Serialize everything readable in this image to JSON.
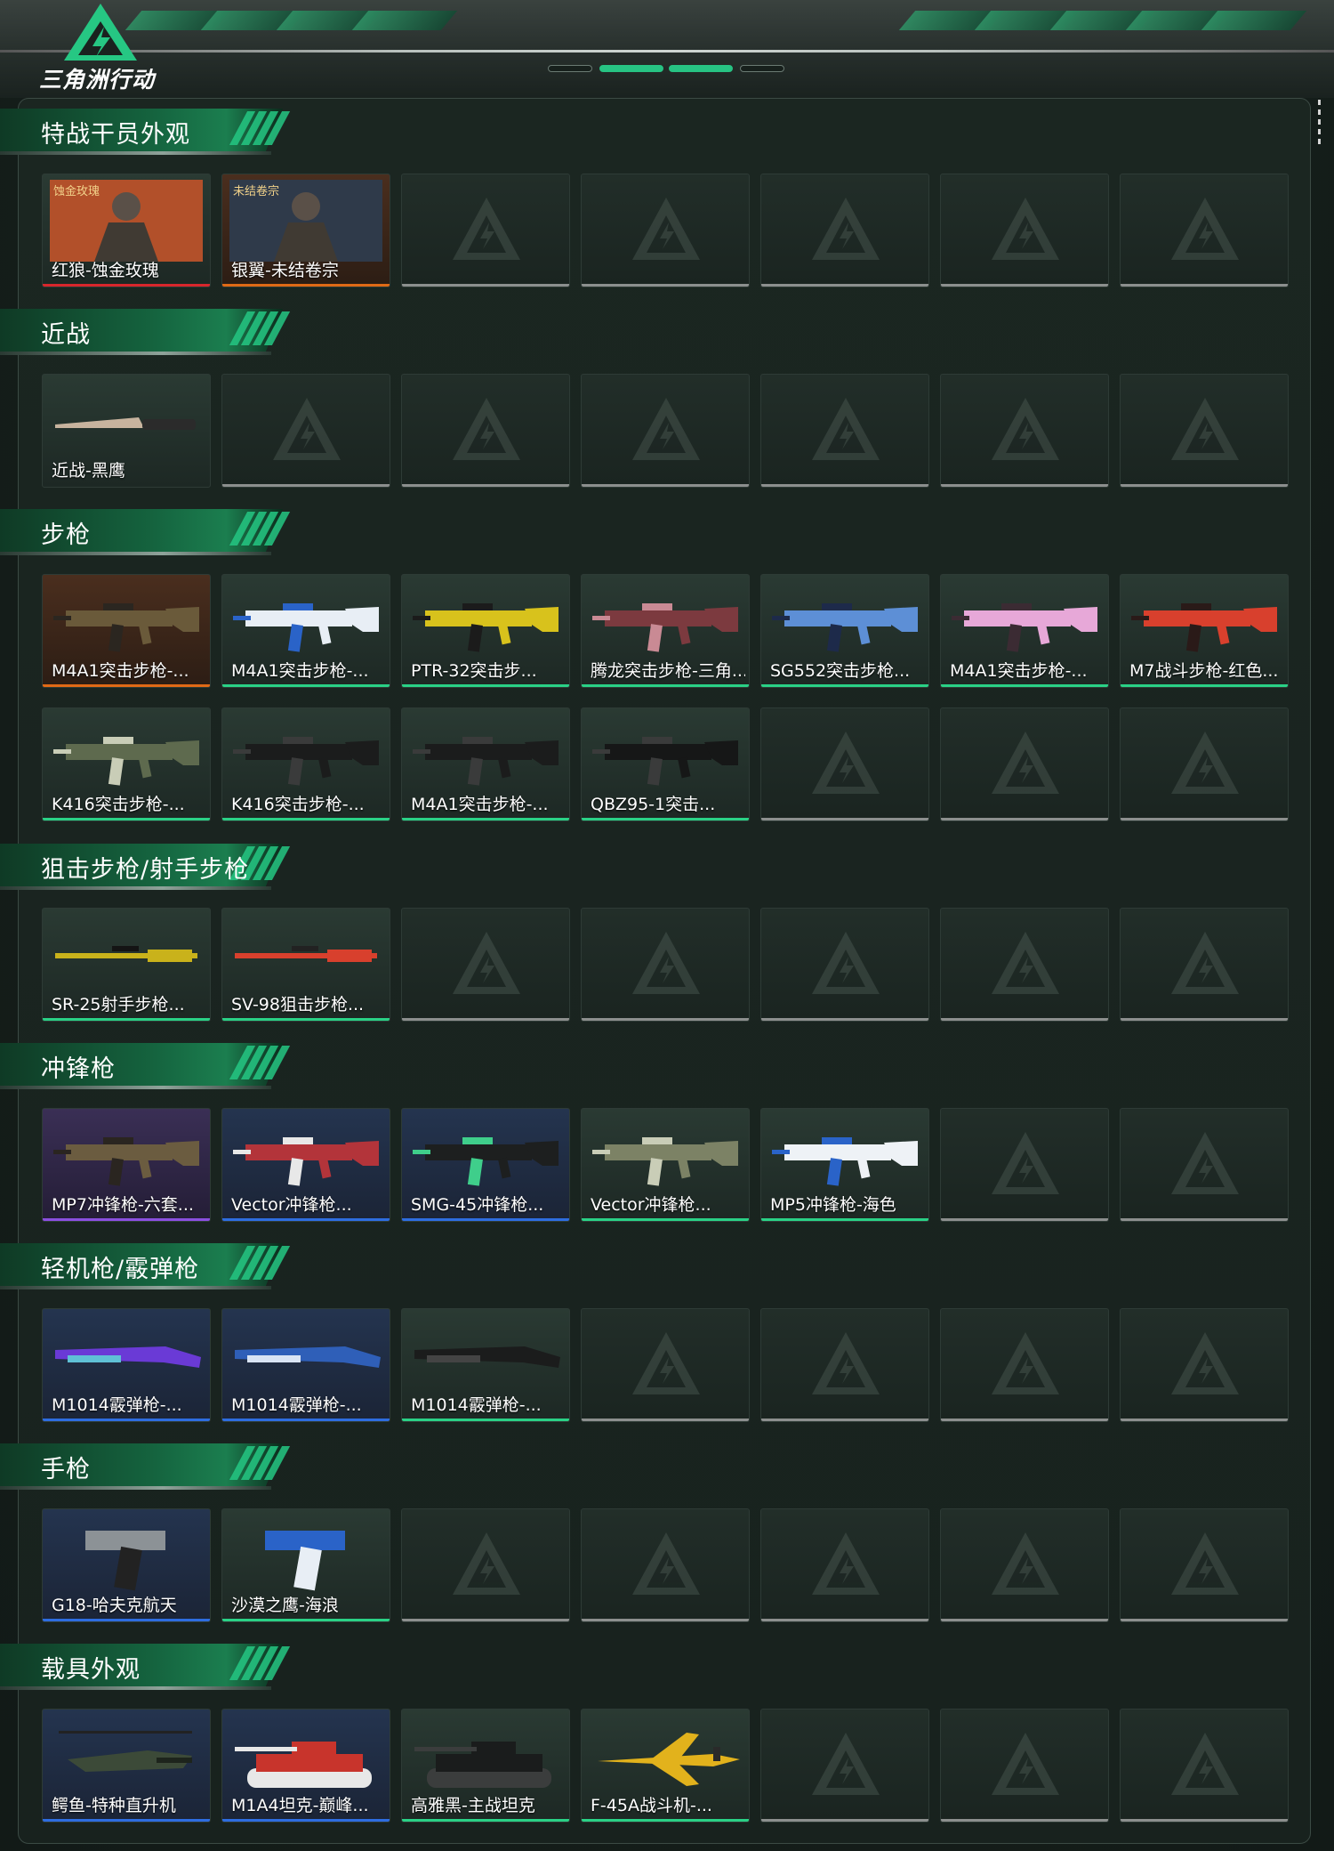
{
  "header": {
    "logo_text": "三角洲行动",
    "accent": "#27c383"
  },
  "sections": [
    {
      "title": "特战干员外观",
      "items": [
        {
          "label": "红狼-蚀金玫瑰",
          "quality": "red",
          "icon": "operator-red-wolf",
          "badge": "蚀金玫瑰"
        },
        {
          "label": "银翼-未结卷宗",
          "quality": "orange",
          "icon": "operator-silver-wing",
          "badge": "未结卷宗"
        }
      ]
    },
    {
      "title": "近战",
      "items": [
        {
          "label": "近战-黑鹰",
          "quality": "none",
          "icon": "knife"
        }
      ]
    },
    {
      "title": "步枪",
      "items": [
        {
          "label": "M4A1突击步枪-...",
          "quality": "orange",
          "icon": "rifle-camo-tan"
        },
        {
          "label": "M4A1突击步枪-...",
          "quality": "green",
          "icon": "rifle-white-blue"
        },
        {
          "label": "PTR-32突击步...",
          "quality": "green",
          "icon": "rifle-yellow-black"
        },
        {
          "label": "腾龙突击步枪-三角...",
          "quality": "green",
          "icon": "rifle-red-camo"
        },
        {
          "label": "SG552突击步枪...",
          "quality": "green",
          "icon": "rifle-blue-marble"
        },
        {
          "label": "M4A1突击步枪-...",
          "quality": "green",
          "icon": "rifle-pink"
        },
        {
          "label": "M7战斗步枪-红色...",
          "quality": "green",
          "icon": "rifle-red"
        },
        {
          "label": "K416突击步枪-...",
          "quality": "green",
          "icon": "rifle-green-camo"
        },
        {
          "label": "K416突击步枪-...",
          "quality": "green",
          "icon": "rifle-black"
        },
        {
          "label": "M4A1突击步枪-...",
          "quality": "green",
          "icon": "rifle-black"
        },
        {
          "label": "QBZ95-1突击...",
          "quality": "green",
          "icon": "rifle-bullpup-black"
        }
      ]
    },
    {
      "title": "狙击步枪/射手步枪",
      "items": [
        {
          "label": "SR-25射手步枪...",
          "quality": "green",
          "icon": "sniper-yellow"
        },
        {
          "label": "SV-98狙击步枪...",
          "quality": "green",
          "icon": "sniper-red"
        }
      ]
    },
    {
      "title": "冲锋枪",
      "items": [
        {
          "label": "MP7冲锋枪-六套...",
          "quality": "purple",
          "icon": "smg-tan"
        },
        {
          "label": "Vector冲锋枪...",
          "quality": "blue",
          "icon": "smg-red-camo"
        },
        {
          "label": "SMG-45冲锋枪...",
          "quality": "blue",
          "icon": "smg-black-green"
        },
        {
          "label": "Vector冲锋枪...",
          "quality": "green",
          "icon": "smg-green-camo"
        },
        {
          "label": "MP5冲锋枪-海色",
          "quality": "green",
          "icon": "smg-white-blue"
        }
      ]
    },
    {
      "title": "轻机枪/霰弹枪",
      "items": [
        {
          "label": "M1014霰弹枪-...",
          "quality": "blue",
          "icon": "shotgun-purple"
        },
        {
          "label": "M1014霰弹枪-...",
          "quality": "blue",
          "icon": "shotgun-blue"
        },
        {
          "label": "M1014霰弹枪-...",
          "quality": "green",
          "icon": "shotgun-black"
        }
      ]
    },
    {
      "title": "手枪",
      "items": [
        {
          "label": "G18-哈夫克航天",
          "quality": "blue",
          "icon": "pistol-silver"
        },
        {
          "label": "沙漠之鹰-海浪",
          "quality": "green",
          "icon": "pistol-blue-wave"
        }
      ]
    },
    {
      "title": "载具外观",
      "items": [
        {
          "label": "鳄鱼-特种直升机",
          "quality": "blue",
          "icon": "helicopter"
        },
        {
          "label": "M1A4坦克-巅峰...",
          "quality": "blue",
          "icon": "tank-red-white"
        },
        {
          "label": "高雅黑-主战坦克",
          "quality": "green",
          "icon": "tank-black"
        },
        {
          "label": "F-45A战斗机-...",
          "quality": "green",
          "icon": "jet-yellow"
        }
      ]
    }
  ]
}
